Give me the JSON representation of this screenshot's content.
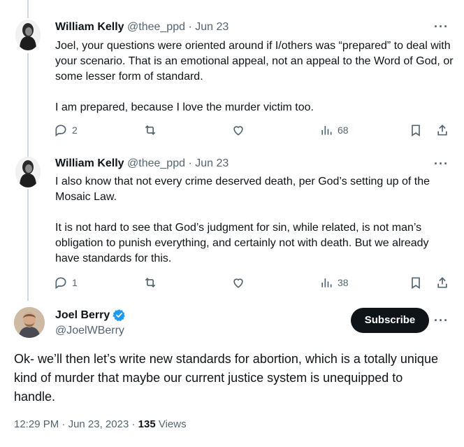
{
  "tweets": [
    {
      "author": "William Kelly",
      "handle": "@thee_ppd",
      "separator": "·",
      "date": "Jun 23",
      "paragraphs": [
        "Joel, your questions were oriented around if I/others was “prepared” to deal with your scenario. That is an emotional appeal, not an appeal to the Word of God, or some lesser form of standard.",
        "I am prepared, because I love the murder victim too."
      ],
      "replies": "2",
      "views": "68",
      "more": "···"
    },
    {
      "author": "William Kelly",
      "handle": "@thee_ppd",
      "separator": "·",
      "date": "Jun 23",
      "paragraphs": [
        "I also know that not every crime deserved death, per God’s setting up of the Mosaic Law.",
        "It is not hard to see that God’s judgment for sin, while related, is not man’s obligation to punish everything, and certainly not with death. But we already have standards for this."
      ],
      "replies": "1",
      "views": "38",
      "more": "···"
    }
  ],
  "main": {
    "author": "Joel Berry",
    "handle": "@JoelWBerry",
    "subscribe_label": "Subscribe",
    "more": "···",
    "text": "Ok- we’ll then let’s write new standards for abortion, which is a totally unique kind of murder that maybe our current justice system is unequipped to handle.",
    "time": "12:29 PM",
    "separator": "·",
    "date": "Jun 23, 2023",
    "views_count": "135",
    "views_label": "Views"
  },
  "icons": {
    "reply": "reply-icon",
    "retweet": "retweet-icon",
    "like": "like-icon",
    "views": "views-icon",
    "bookmark": "bookmark-icon",
    "share": "share-icon",
    "verified": "verified-badge-icon"
  },
  "colors": {
    "text": "#0f1419",
    "secondary": "#536471",
    "verified": "#1d9bf0",
    "thread_line": "#cfd9de",
    "subscribe_bg": "#0f1419"
  }
}
